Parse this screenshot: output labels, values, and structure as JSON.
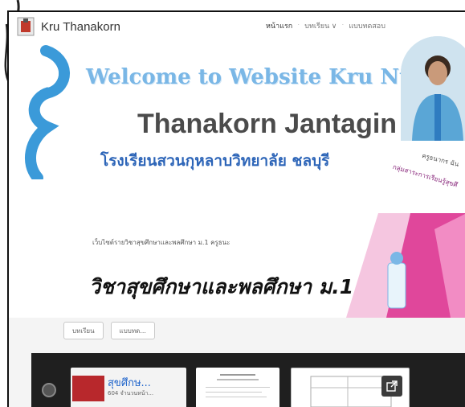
{
  "header": {
    "site_name": "Kru Thanakorn",
    "nav": {
      "home": "หน้าแรก",
      "lessons": "บทเรียน ∨",
      "tests": "แบบทดสอบ"
    },
    "welcome": "Welcome to Website Kru Nut",
    "name": "Thanakorn Jantagin",
    "school": "โรงเรียนสวนกุหลาบวิทยาลัย ชลบุรี",
    "caption_1": "ครูธนากร ฉัน",
    "caption_2": "กลุ่มสาระการเรียนรู้สุขศึ"
  },
  "banner": {
    "subtitle": "เว็บไซต์รายวิชาสุขศึกษาและพลศึกษา ม.1 ครูธนะ",
    "title": "วิชาสุขศึกษาและพลศึกษา ม.1"
  },
  "buttons": {
    "lessons": "บทเรียน",
    "tests": "แบบทด..."
  },
  "gallery": {
    "card1_title": "สุขศึกษ...",
    "card1_sub": "604 จำนวนหน้า..."
  },
  "colors": {
    "welcome": "#7ab7e6",
    "name": "#4b4b4b",
    "school": "#2d65b8",
    "accent_pink": "#e0479b",
    "strip": "#1f1f1f"
  }
}
